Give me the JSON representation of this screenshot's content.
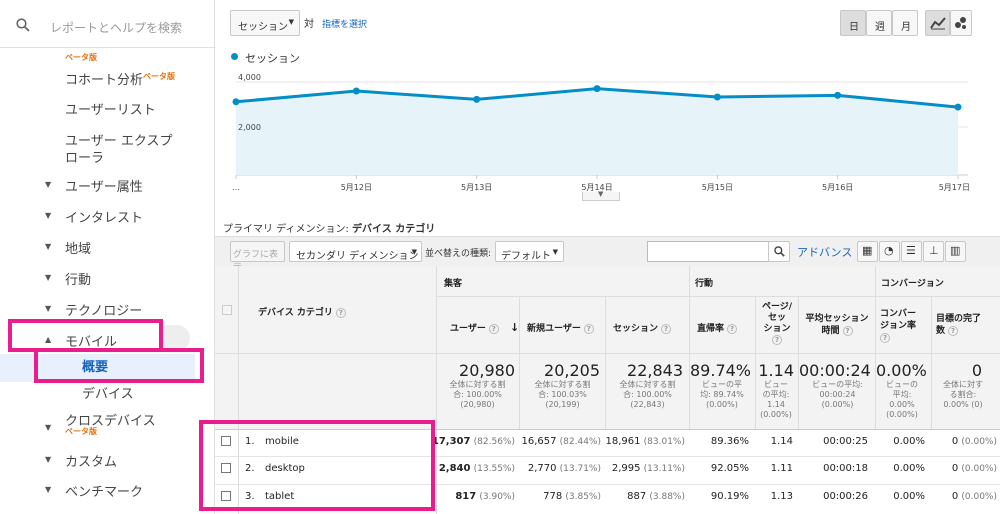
{
  "search": {
    "placeholder": "レポートとヘルプを検索"
  },
  "sidebar": {
    "beta_top": "ベータ版",
    "cohort": "コホート分析",
    "cohort_beta": "ベータ版",
    "userlist": "ユーザーリスト",
    "explorer": "ユーザー エクスプローラ",
    "explorer_line1": "ユーザー エクスプ",
    "explorer_line2": "ローラ",
    "items": [
      {
        "label": "ユーザー属性"
      },
      {
        "label": "インタレスト"
      },
      {
        "label": "地域"
      },
      {
        "label": "行動"
      },
      {
        "label": "テクノロジー"
      },
      {
        "label": "モバイル"
      }
    ],
    "mobile_sub": [
      "概要",
      "デバイス"
    ],
    "crossdevice": "クロスデバイス",
    "crossdevice_beta": "ベータ版",
    "custom": "カスタム",
    "benchmark": "ベンチマーク"
  },
  "toolbar": {
    "metric_select": "セッション",
    "vs": "対",
    "select_metric": "指標を選択",
    "periods": [
      "日",
      "週",
      "月"
    ]
  },
  "chart_data": {
    "type": "line",
    "title": "",
    "series": [
      {
        "name": "セッション",
        "values": [
          3050,
          3500,
          3150,
          3600,
          3250,
          3320,
          2830
        ]
      }
    ],
    "x": [
      "…",
      "5月12日",
      "5月13日",
      "5月14日",
      "5月15日",
      "5月16日",
      "5月17日"
    ],
    "yticks": [
      "4,000",
      "2,000"
    ],
    "ylim": [
      0,
      4000
    ],
    "color": "#058dc7"
  },
  "dimension": {
    "label": "プライマリ ディメンション:",
    "value": "デバイス カテゴリ"
  },
  "controls": {
    "graph_btn": "グラフに表示",
    "secondary": "セカンダリ ディメンション",
    "sort_label": "並べ替えの種類:",
    "sort_value": "デフォルト",
    "advanced": "アドバンス"
  },
  "table": {
    "col_dim": "デバイス カテゴリ",
    "groups": [
      "集客",
      "行動",
      "コンバージョン"
    ],
    "headers": [
      "ユーザー",
      "新規ユーザー",
      "セッション",
      "直帰率",
      "ページ/セッション",
      "平均セッション時間",
      "コンバージョン率",
      "目標の完了数"
    ],
    "h_pages_1": "ページ/",
    "h_pages_2": "セッ",
    "h_pages_3": "ション",
    "h_time_1": "平均セッション",
    "h_time_2": "時間",
    "h_conv_1": "コンバー",
    "h_conv_2": "ジョン率",
    "h_goal_1": "目標の完了",
    "h_goal_2": "数",
    "totals": {
      "users": "20,980",
      "users_s1": "全体に対する割",
      "users_s2": "合: 100.00%",
      "users_s3": "(20,980)",
      "new": "20,205",
      "new_s1": "全体に対する割",
      "new_s2": "合: 100.03%",
      "new_s3": "(20,199)",
      "sess": "22,843",
      "sess_s1": "全体に対する割",
      "sess_s2": "合: 100.00%",
      "sess_s3": "(22,843)",
      "bounce": "89.74%",
      "bounce_s1": "ビューの平",
      "bounce_s2": "均: 89.74%",
      "bounce_s3": "(0.00%)",
      "pps": "1.14",
      "pps_s1": "ビュー",
      "pps_s2": "の平均:",
      "pps_s3": "1.14",
      "pps_s4": "(0.00%)",
      "time": "00:00:24",
      "time_s1": "ビューの平均:",
      "time_s2": "00:00:24",
      "time_s3": "(0.00%)",
      "conv": "0.00%",
      "conv_s1": "ビューの",
      "conv_s2": "平均:",
      "conv_s3": "0.00%",
      "conv_s4": "(0.00%)",
      "goal": "0",
      "goal_s1": "全体に対す",
      "goal_s2": "る割合:",
      "goal_s3": "0.00% (0)"
    },
    "rows": [
      {
        "idx": "1.",
        "name": "mobile",
        "users": "17,307",
        "users_p": "(82.56%)",
        "new": "16,657",
        "new_p": "(82.44%)",
        "sess": "18,961",
        "sess_p": "(83.01%)",
        "bounce": "89.36%",
        "pps": "1.14",
        "time": "00:00:25",
        "conv": "0.00%",
        "goal": "0",
        "goal_p": "(0.00%)"
      },
      {
        "idx": "2.",
        "name": "desktop",
        "users": "2,840",
        "users_p": "(13.55%)",
        "new": "2,770",
        "new_p": "(13.71%)",
        "sess": "2,995",
        "sess_p": "(13.11%)",
        "bounce": "92.05%",
        "pps": "1.11",
        "time": "00:00:18",
        "conv": "0.00%",
        "goal": "0",
        "goal_p": "(0.00%)"
      },
      {
        "idx": "3.",
        "name": "tablet",
        "users": "817",
        "users_p": "(3.90%)",
        "new": "778",
        "new_p": "(3.85%)",
        "sess": "887",
        "sess_p": "(3.88%)",
        "bounce": "90.19%",
        "pps": "1.13",
        "time": "00:00:26",
        "conv": "0.00%",
        "goal": "0",
        "goal_p": "(0.00%)"
      }
    ]
  }
}
